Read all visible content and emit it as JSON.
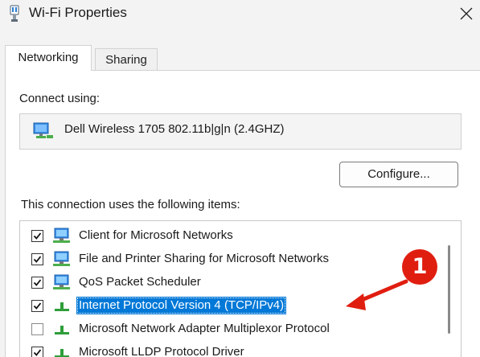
{
  "window": {
    "title": "Wi-Fi Properties",
    "close_icon": "close-icon"
  },
  "tabs": [
    {
      "label": "Networking",
      "active": true
    },
    {
      "label": "Sharing",
      "active": false
    }
  ],
  "connect_using": {
    "label": "Connect using:",
    "adapter_name": "Dell Wireless 1705 802.11b|g|n (2.4GHZ)",
    "adapter_icon": "network-adapter-icon"
  },
  "configure_button": {
    "label": "Configure..."
  },
  "items_section": {
    "label": "This connection uses the following items:",
    "items": [
      {
        "label": "Client for Microsoft Networks",
        "checked": true,
        "icon": "network-client-icon"
      },
      {
        "label": "File and Printer Sharing for Microsoft Networks",
        "checked": true,
        "icon": "network-service-icon"
      },
      {
        "label": "QoS Packet Scheduler",
        "checked": true,
        "icon": "network-service-icon"
      },
      {
        "label": "Internet Protocol Version 4 (TCP/IPv4)",
        "checked": true,
        "selected": true,
        "icon": "protocol-icon"
      },
      {
        "label": "Microsoft Network Adapter Multiplexor Protocol",
        "checked": false,
        "icon": "protocol-icon"
      },
      {
        "label": "Microsoft LLDP Protocol Driver",
        "checked": true,
        "icon": "protocol-icon"
      }
    ]
  },
  "annotation": {
    "number": "1",
    "color": "#e01e10"
  },
  "colors": {
    "selection": "#0078d7",
    "background": "#f3f3f3"
  }
}
